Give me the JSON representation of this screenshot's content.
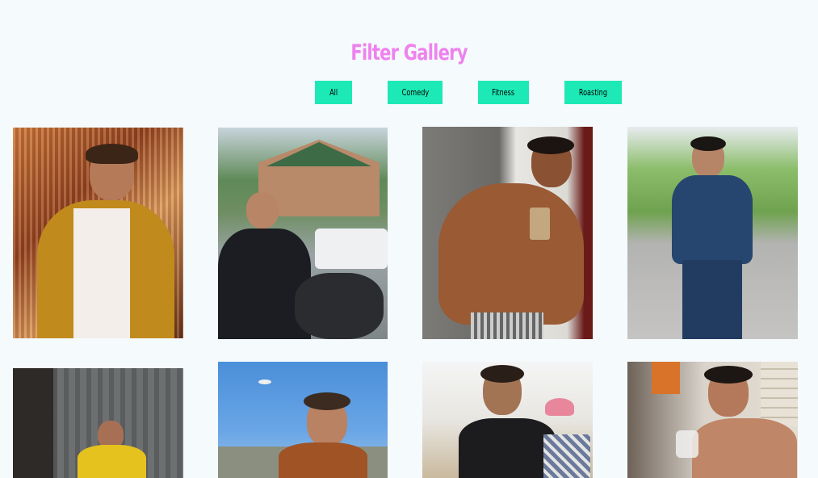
{
  "gallery": {
    "title": "Filter Gallery",
    "filters": [
      {
        "label": "All"
      },
      {
        "label": "Comedy"
      },
      {
        "label": "Fitness"
      },
      {
        "label": "Roasting"
      }
    ]
  },
  "colors": {
    "background": "#f5fafd",
    "title": "#ee82ee",
    "filter_button": "#1de9b6"
  }
}
